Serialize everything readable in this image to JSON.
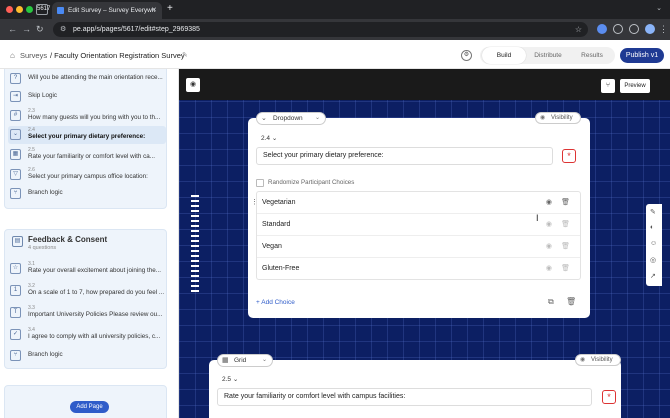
{
  "browser": {
    "tab_count": "5617",
    "tab_title": "Edit Survey – Survey Everywh",
    "url": "pe.app/s/pages/5617/edit#step_2969385"
  },
  "header": {
    "breadcrumb_root": "Surveys",
    "breadcrumb_title": "/ Faculty Orientation Registration Survey",
    "tabs": {
      "build": "Build",
      "distribute": "Distribute",
      "results": "Results"
    },
    "publish": "Publish v1"
  },
  "sidebar": {
    "top_items": [
      {
        "num": "",
        "text": "Will you be attending the main orientation rece..."
      },
      {
        "num": "",
        "text": "Skip Logic"
      },
      {
        "num": "2.3",
        "text": "How many guests will you bring with you to th..."
      },
      {
        "num": "2.4",
        "text": "Select your primary dietary preference:"
      },
      {
        "num": "2.5",
        "text": "Rate your familiarity or comfort level with ca..."
      },
      {
        "num": "2.6",
        "text": "Select your primary campus office location:"
      },
      {
        "num": "",
        "text": "Branch logic"
      }
    ],
    "section2": {
      "title": "Feedback & Consent",
      "subtitle": "4 questions",
      "items": [
        {
          "num": "3.1",
          "text": "Rate your overall excitement about joining the..."
        },
        {
          "num": "3.2",
          "text": "On a scale of 1 to 7, how prepared do you feel ..."
        },
        {
          "num": "3.3",
          "text": "Important University Policies Please review ou..."
        },
        {
          "num": "3.4",
          "text": "I agree to comply with all university policies, c..."
        },
        {
          "num": "",
          "text": "Branch logic"
        }
      ]
    },
    "add_page": "Add Page"
  },
  "canvas": {
    "preview": "Preview",
    "card1": {
      "type": "Dropdown",
      "visibility": "Visibility",
      "number": "2.4",
      "question": "Select your primary dietary preference:",
      "randomize": "Randomize Participant Choices",
      "choices": [
        "Vegetarian",
        "Standard",
        "Vegan",
        "Gluten-Free"
      ],
      "add_choice": "+ Add Choice"
    },
    "card2": {
      "type": "Grid",
      "visibility": "Visibility",
      "number": "2.5",
      "question": "Rate your familiarity or comfort level with campus facilities:"
    }
  },
  "colors": {
    "accent": "#1f3a93",
    "canvas_bg": "#0c1f63",
    "required": "#d33333",
    "link": "#2f5cc9"
  }
}
